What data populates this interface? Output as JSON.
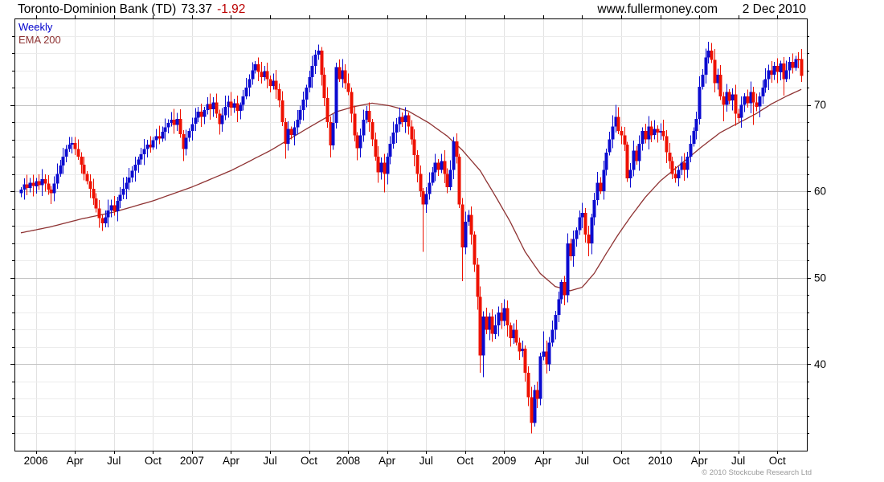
{
  "header": {
    "title": "Toronto-Dominion Bank (TD)",
    "last": "73.37",
    "change": "-1.92",
    "site": "www.fullermoney.com",
    "date": "2 Dec 2010"
  },
  "legend": {
    "weekly": "Weekly",
    "ema": "EMA 200"
  },
  "footer": {
    "copyright": "© 2010 Stockcube Research Ltd"
  },
  "colors": {
    "up": "#0b0bd0",
    "down": "#ee1100",
    "ema": "#8e3232",
    "weekly_text": "#0000cd",
    "change_text": "#bb0000",
    "grid_minor": "#ececec",
    "grid_major": "#c2c2c2",
    "grid_vert": "#e2e2e2",
    "axis_text": "#000000",
    "border": "#000000",
    "copyright_text": "#999999"
  },
  "chart_data": {
    "type": "candlestick+line",
    "title": "Toronto-Dominion Bank (TD) weekly candles with 200 EMA",
    "interval": "weekly",
    "ylim": [
      30,
      80
    ],
    "y_ticks": [
      40,
      50,
      60,
      70
    ],
    "y_minor_step": 2,
    "x_tick_labels": [
      "2006",
      "Apr",
      "Jul",
      "Oct",
      "2007",
      "Apr",
      "Jul",
      "Oct",
      "2008",
      "Apr",
      "Jul",
      "Oct",
      "2009",
      "Apr",
      "Jul",
      "Oct",
      "2010",
      "Apr",
      "Jul",
      "Oct"
    ],
    "first_open": 59.8,
    "last_close": 73.37,
    "last_change": -1.92,
    "weekly_closes": [
      60.2,
      60.8,
      60.4,
      61.0,
      60.6,
      61.2,
      60.7,
      61.4,
      60.9,
      60.2,
      59.8,
      60.9,
      62.0,
      63.0,
      64.0,
      64.9,
      65.4,
      65.6,
      64.9,
      64.0,
      63.1,
      62.0,
      61.2,
      60.3,
      59.2,
      58.0,
      56.9,
      56.3,
      57.0,
      57.8,
      58.4,
      57.7,
      58.9,
      59.6,
      60.3,
      61.0,
      61.6,
      62.4,
      63.1,
      63.7,
      64.3,
      64.9,
      65.4,
      65.1,
      65.9,
      66.4,
      66.1,
      66.9,
      67.4,
      67.9,
      68.3,
      67.7,
      68.4,
      66.6,
      64.9,
      66.2,
      67.0,
      67.8,
      68.5,
      69.2,
      68.6,
      69.4,
      70.1,
      69.5,
      70.3,
      69.0,
      67.8,
      68.8,
      69.8,
      70.4,
      69.7,
      70.2,
      69.3,
      70.0,
      71.0,
      72.0,
      73.0,
      74.0,
      74.7,
      73.8,
      73.2,
      73.9,
      73.0,
      72.2,
      72.8,
      71.8,
      70.5,
      68.0,
      65.5,
      67.2,
      66.5,
      67.4,
      68.3,
      69.4,
      70.6,
      72.0,
      73.2,
      74.5,
      75.8,
      76.3,
      73.5,
      70.8,
      68.0,
      65.3,
      67.9,
      74.4,
      73.0,
      74.0,
      72.5,
      71.5,
      69.0,
      66.5,
      65.0,
      66.5,
      68.3,
      69.3,
      68.0,
      66.0,
      64.0,
      62.2,
      63.3,
      62.0,
      64.0,
      65.5,
      66.8,
      67.8,
      68.6,
      68.0,
      68.8,
      67.5,
      66.0,
      64.2,
      62.0,
      60.0,
      58.5,
      59.7,
      61.0,
      62.2,
      63.3,
      62.5,
      63.5,
      62.0,
      60.5,
      62.5,
      65.8,
      64.0,
      58.5,
      53.5,
      56.5,
      57.3,
      55.0,
      51.5,
      47.8,
      41.0,
      45.5,
      44.0,
      45.5,
      43.5,
      44.5,
      46.0,
      45.0,
      46.5,
      44.5,
      43.0,
      44.0,
      42.5,
      41.5,
      41.8,
      39.0,
      36.2,
      33.2,
      37.0,
      36.0,
      40.9,
      41.5,
      40.0,
      42.5,
      44.0,
      45.7,
      47.5,
      49.5,
      48.0,
      54.0,
      52.5,
      54.5,
      55.5,
      57.0,
      57.5,
      55.0,
      54.0,
      57.0,
      59.0,
      61.0,
      60.0,
      62.5,
      64.5,
      66.0,
      67.5,
      68.6,
      67.0,
      66.5,
      65.4,
      61.5,
      62.5,
      64.7,
      63.5,
      65.5,
      67.0,
      66.0,
      67.5,
      66.5,
      67.2,
      66.8,
      67.0,
      66.4,
      64.5,
      63.5,
      62.0,
      61.5,
      62.5,
      63.3,
      62.5,
      64.0,
      65.5,
      67.0,
      68.4,
      72.1,
      73.5,
      75.5,
      76.3,
      75.2,
      72.5,
      73.5,
      71.0,
      70.0,
      71.5,
      70.5,
      71.2,
      69.0,
      68.5,
      70.0,
      71.0,
      70.2,
      71.5,
      70.3,
      69.8,
      71.0,
      72.0,
      73.0,
      74.0,
      73.5,
      74.5,
      73.8,
      74.8,
      73.0,
      74.0,
      75.0,
      74.3,
      75.3,
      75.29,
      73.37
    ],
    "wick_overrides": {
      "17": [
        66.3,
        null
      ],
      "27": [
        null,
        55.4
      ],
      "54": [
        null,
        63.5
      ],
      "88": [
        null,
        63.8
      ],
      "99": [
        77.0,
        null
      ],
      "103": [
        null,
        63.9
      ],
      "104": [
        null,
        64.8
      ],
      "112": [
        null,
        63.6
      ],
      "119": [
        null,
        61.0
      ],
      "121": [
        null,
        59.9
      ],
      "134": [
        null,
        53.0
      ],
      "147": [
        null,
        49.6
      ],
      "152": [
        null,
        46.3
      ],
      "153": [
        null,
        39.0
      ],
      "154": [
        null,
        38.5
      ],
      "161": [
        47.5,
        null
      ],
      "168": [
        null,
        38.0
      ],
      "170": [
        null,
        32.0
      ],
      "174": [
        43.8,
        null
      ],
      "189": [
        null,
        52.5
      ],
      "198": [
        70.0,
        null
      ],
      "218": [
        null,
        61.0
      ],
      "229": [
        77.3,
        null
      ],
      "234": [
        null,
        68.1
      ],
      "238": [
        null,
        67.6
      ],
      "244": [
        null,
        67.7
      ],
      "254": [
        null,
        71.1
      ]
    },
    "ema200": [
      [
        0,
        55.2
      ],
      [
        10,
        55.9
      ],
      [
        20,
        56.8
      ],
      [
        31,
        57.6
      ],
      [
        44,
        58.9
      ],
      [
        57,
        60.5
      ],
      [
        70,
        62.4
      ],
      [
        83,
        64.7
      ],
      [
        96,
        67.4
      ],
      [
        105,
        69.2
      ],
      [
        111,
        69.8
      ],
      [
        117,
        70.2
      ],
      [
        123,
        69.9
      ],
      [
        129,
        69.3
      ],
      [
        136,
        67.9
      ],
      [
        142,
        66.4
      ],
      [
        147,
        64.8
      ],
      [
        153,
        62.4
      ],
      [
        158,
        59.5
      ],
      [
        163,
        56.5
      ],
      [
        168,
        53.0
      ],
      [
        173,
        50.5
      ],
      [
        178,
        49.0
      ],
      [
        183,
        48.5
      ],
      [
        187,
        48.9
      ],
      [
        191,
        50.5
      ],
      [
        195,
        52.8
      ],
      [
        199,
        55.0
      ],
      [
        203,
        57.0
      ],
      [
        208,
        59.3
      ],
      [
        213,
        61.2
      ],
      [
        220,
        63.2
      ],
      [
        227,
        65.2
      ],
      [
        233,
        66.8
      ],
      [
        239,
        67.9
      ],
      [
        245,
        69.0
      ],
      [
        250,
        70.1
      ],
      [
        255,
        71.0
      ],
      [
        260,
        71.8
      ]
    ]
  }
}
